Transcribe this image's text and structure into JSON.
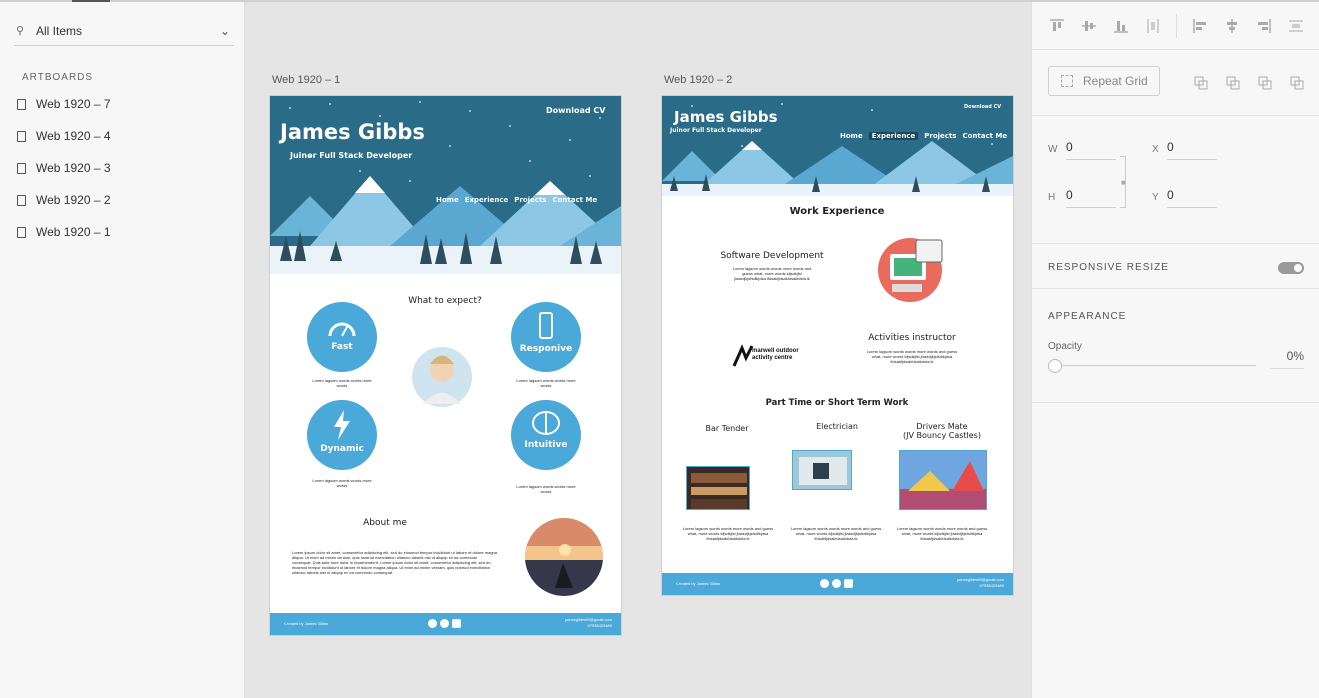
{
  "left_panel": {
    "search_label": "All Items",
    "section_title": "ARTBOARDS",
    "artboards": [
      "Web 1920 – 7",
      "Web 1920 – 4",
      "Web 1920 – 3",
      "Web 1920 – 2",
      "Web 1920 – 1"
    ]
  },
  "board1": {
    "label": "Web 1920 – 1",
    "name": "James Gibbs",
    "role": "Juinor Full Stack Developer",
    "download": "Download CV",
    "nav": [
      "Home",
      "Experience",
      "Projects",
      "Contact Me"
    ],
    "section_title": "What to expect?",
    "features": [
      {
        "label": "Fast",
        "text": "Lorem lagsom words words more words"
      },
      {
        "label": "Responive",
        "text": "Lorem lagsom words words more words"
      },
      {
        "label": "Dynamic",
        "text": "Lorem lagsom words words more words"
      },
      {
        "label": "Intuitive",
        "text": "Lorem lagsom words words more words"
      }
    ],
    "about_title": "About me",
    "about_text": "Lorem ipsum dolor sit amet, consectetur adipiscing elit, sed do eiusmod tempor incididunt ut labore et dolore magna aliqua. Ut enim ad minim veniam, quis nostrud exercitation ullamco laboris nisi ut aliquip ex ea commodo consequat. Duis aute irure dolor in reprehenderit. Lorem ipsum dolor sit amet, consectetur adipiscing elit, sed do eiusmod tempor incididunt ut labore et dolore magna aliqua. Ut enim ad minim veniam, quis nostrud exercitation ullamco laboris nisi ut aliquip ex ea commodo consequat.",
    "footer_left": "Created by James Gibbs",
    "footer_right": "jamesgibbs89@gmail.com 07938429480"
  },
  "board2": {
    "label": "Web 1920 – 2",
    "name": "James Gibbs",
    "role": "Juinor Full Stack Developer",
    "download": "Download CV",
    "nav": [
      "Home",
      "Experience",
      "Projects",
      "Contact Me"
    ],
    "title": "Work Experience",
    "job1_title": "Software Development",
    "job1_text": "Lorem lagsom words words more words and guess what, more words kfjsdkjfsl jlaskdjkjsfsdlkjdsa lfdsakfjdsakfdsalkdsfa.lk",
    "company_logo": "marwell outdoor activity centre",
    "job2_title": "Activities instructor",
    "job2_text": "Lorem lagsom words words more words and guess what, more words kfjsdkjfsl jlaskdjkjsfsdlkjdsa lfdsakfjdsakfdsalkdsfa.lk",
    "part_title": "Part Time or Short Term Work",
    "parts": [
      {
        "title": "Bar Tender",
        "text": "Lorem lagsom words words more words and guess what, more words kfjsdkjfsl jlaskdjkjsfsdlkjdsa lfdsakfjdsakfdsalkdsfa.lk"
      },
      {
        "title": "Electrician",
        "text": "Lorem lagsom words words more words and guess what, more words kfjsdkjfsl jlaskdjkjsfsdlkjdsa lfdsakfjdsakfdsalkdsfa.lk"
      },
      {
        "title": "Drivers Mate\n(JV Bouncy Castles)",
        "text": "Lorem lagsom words words more words and guess what, more words kfjsdkjfsl jlaskdjkjsfsdlkjdsa lfdsakfjdsakfdsalkdsfa.lk"
      }
    ],
    "footer_left": "Created by James Gibbs",
    "footer_right": "jamesgibbs89@gmail.com 07938429480"
  },
  "right_panel": {
    "repeat_grid": "Repeat Grid",
    "w_label": "W",
    "w_value": "0",
    "x_label": "X",
    "x_value": "0",
    "h_label": "H",
    "h_value": "0",
    "y_label": "Y",
    "y_value": "0",
    "responsive_resize": "RESPONSIVE RESIZE",
    "appearance": "APPEARANCE",
    "opacity_label": "Opacity",
    "opacity_value": "0%"
  },
  "colors": {
    "accent": "#4aa9d9",
    "hero": "#2a6b87"
  }
}
